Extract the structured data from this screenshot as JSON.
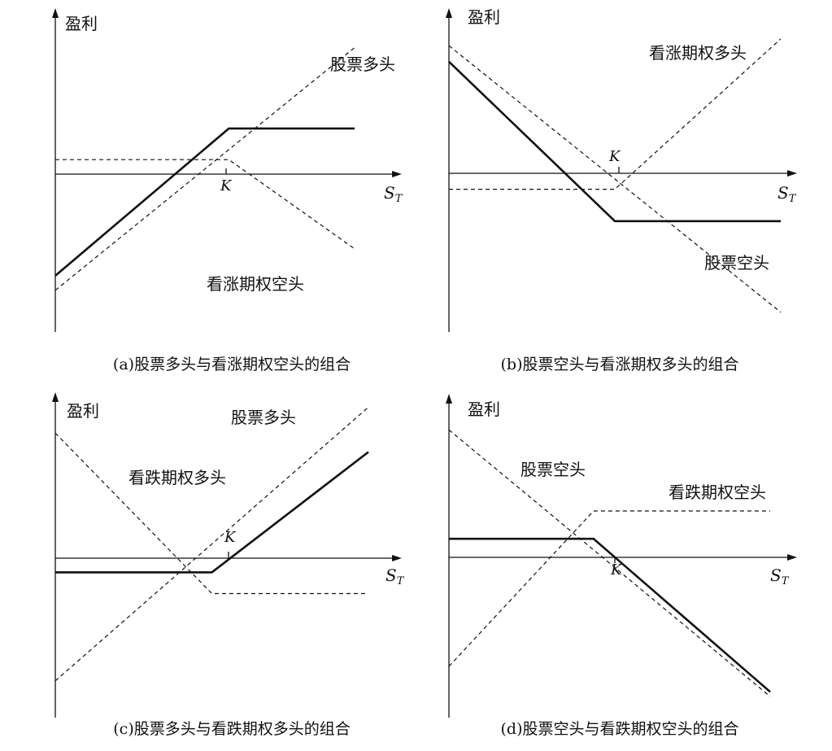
{
  "charts": [
    {
      "type": "line",
      "caption": "(a)股票多头与看涨期权空头的组合",
      "ylabel": "盈利",
      "xlabel": "S",
      "xlabel_sub": "T",
      "strike_label": "K",
      "series": [
        {
          "name": "股票多头",
          "style": "dashed",
          "x": [
            0,
            100
          ],
          "y": [
            -56,
            61
          ]
        },
        {
          "name": "看涨期权空头",
          "style": "dashed",
          "x": [
            0,
            58,
            100
          ],
          "y": [
            7,
            7,
            -36
          ]
        },
        {
          "style": "solid",
          "x": [
            0,
            58,
            100
          ],
          "y": [
            -49,
            22,
            22
          ]
        }
      ]
    },
    {
      "type": "line",
      "caption": "(b)股票空头与看涨期权多头的组合",
      "ylabel": "盈利",
      "xlabel": "S",
      "xlabel_sub": "T",
      "strike_label": "K",
      "series": [
        {
          "name": "看涨期权多头",
          "style": "dashed",
          "x": [
            0,
            50,
            100
          ],
          "y": [
            -7,
            -7,
            59
          ]
        },
        {
          "name": "股票空头",
          "style": "dashed",
          "x": [
            0,
            100
          ],
          "y": [
            56,
            -61
          ]
        },
        {
          "style": "solid",
          "x": [
            0,
            50,
            100
          ],
          "y": [
            49,
            -21,
            -21
          ]
        }
      ]
    },
    {
      "type": "line",
      "caption": "(c)股票多头与看跌期权多头的组合",
      "ylabel": "盈利",
      "xlabel": "S",
      "xlabel_sub": "T",
      "strike_label": "K",
      "series": [
        {
          "name": "股票多头",
          "style": "dashed",
          "x": [
            0,
            100
          ],
          "y": [
            -52,
            64
          ]
        },
        {
          "name": "看跌期权多头",
          "style": "dashed",
          "x": [
            0,
            50,
            100
          ],
          "y": [
            53,
            -15,
            -15
          ]
        },
        {
          "style": "solid",
          "x": [
            0,
            50,
            100
          ],
          "y": [
            -6,
            -6,
            45
          ]
        }
      ]
    },
    {
      "type": "line",
      "caption": "(d)股票空头与看跌期权空头的组合",
      "ylabel": "盈利",
      "xlabel": "S",
      "xlabel_sub": "T",
      "strike_label": "K",
      "series": [
        {
          "name": "股票空头",
          "style": "dashed",
          "x": [
            0,
            100
          ],
          "y": [
            55,
            -60
          ]
        },
        {
          "name": "看跌期权空头",
          "style": "dashed",
          "x": [
            0,
            45,
            100
          ],
          "y": [
            -47,
            20,
            20
          ]
        },
        {
          "style": "solid",
          "x": [
            0,
            45,
            100
          ],
          "y": [
            8,
            8,
            -58
          ]
        }
      ]
    }
  ]
}
